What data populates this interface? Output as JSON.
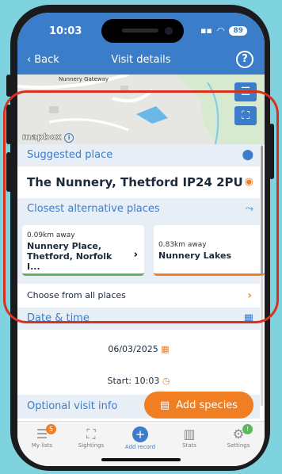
{
  "status_bar": {
    "time": "10:03",
    "battery": "89"
  },
  "nav": {
    "back_label": "Back",
    "title": "Visit details",
    "help": "?"
  },
  "map": {
    "street_label": "Nunnery Gateway",
    "logo": "mapbox",
    "info": "i"
  },
  "suggested": {
    "heading": "Suggested place",
    "place": "The Nunnery, Thetford IP24 2PU"
  },
  "alternatives": {
    "heading": "Closest alternative places",
    "cards": [
      {
        "distance": "0.09km away",
        "name": "Nunnery Place, Thetford, Norfolk I...",
        "accent": "#5cb85c"
      },
      {
        "distance": "0.83km away",
        "name": "Nunnery Lakes",
        "accent": "#f07e22"
      }
    ],
    "choose_all": "Choose from all places"
  },
  "datetime": {
    "heading": "Date & time",
    "date": "06/03/2025",
    "start_label": "Start:",
    "start_time": "10:03"
  },
  "optional": {
    "heading": "Optional visit info",
    "add_species": "Add species"
  },
  "tabs": [
    {
      "label": "My lists",
      "icon": "list-icon",
      "badge": "5"
    },
    {
      "label": "Sightings",
      "icon": "map-pin-icon"
    },
    {
      "label": "Add record",
      "icon": "plus-icon",
      "active": true
    },
    {
      "label": "Stats",
      "icon": "bar-chart-icon"
    },
    {
      "label": "Settings",
      "icon": "gears-icon",
      "badge": "!"
    }
  ],
  "colors": {
    "primary": "#3b7dc9",
    "accent": "#f07e22",
    "annotation": "#d6321f"
  }
}
